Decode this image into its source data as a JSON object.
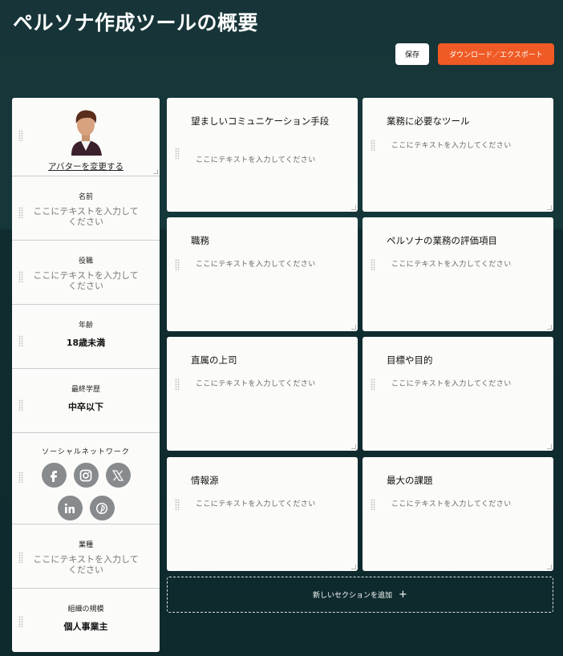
{
  "header": {
    "title": "ペルソナ作成ツールの概要",
    "save_label": "保存",
    "export_label": "ダウンロード／エクスポート"
  },
  "sidebar": {
    "avatar_link": "アバターを変更する",
    "fields": [
      {
        "label": "名前",
        "placeholder": "ここにテキストを入力してください"
      },
      {
        "label": "役職",
        "placeholder": "ここにテキストを入力してください"
      },
      {
        "label": "年齢",
        "value": "18歳未満"
      },
      {
        "label": "最終学歴",
        "value": "中卒以下"
      },
      {
        "label": "ソーシャルネットワーク"
      },
      {
        "label": "業種",
        "placeholder": "ここにテキストを入力してください"
      },
      {
        "label": "組織の規模",
        "value": "個人事業主"
      }
    ],
    "social_icons": [
      "facebook-icon",
      "instagram-icon",
      "x-icon",
      "linkedin-icon",
      "pinterest-icon"
    ]
  },
  "cards": [
    {
      "title": "望ましいコミュニケーション手段",
      "placeholder": "ここにテキストを入力してください"
    },
    {
      "title": "業務に必要なツール",
      "placeholder": "ここにテキストを入力してください"
    },
    {
      "title": "職務",
      "placeholder": "ここにテキストを入力してください"
    },
    {
      "title": "ペルソナの業務の評価項目",
      "placeholder": "ここにテキストを入力してください"
    },
    {
      "title": "直属の上司",
      "placeholder": "ここにテキストを入力してください"
    },
    {
      "title": "目標や目的",
      "placeholder": "ここにテキストを入力してください"
    },
    {
      "title": "情報源",
      "placeholder": "ここにテキストを入力してください"
    },
    {
      "title": "最大の課題",
      "placeholder": "ここにテキストを入力してください"
    }
  ],
  "add_section": {
    "label": "新しいセクションを追加",
    "icon": "+"
  },
  "colors": {
    "background": "#15373a",
    "accent": "#f05a24",
    "card": "#fbfbf9",
    "social_icon": "#878b8d"
  }
}
